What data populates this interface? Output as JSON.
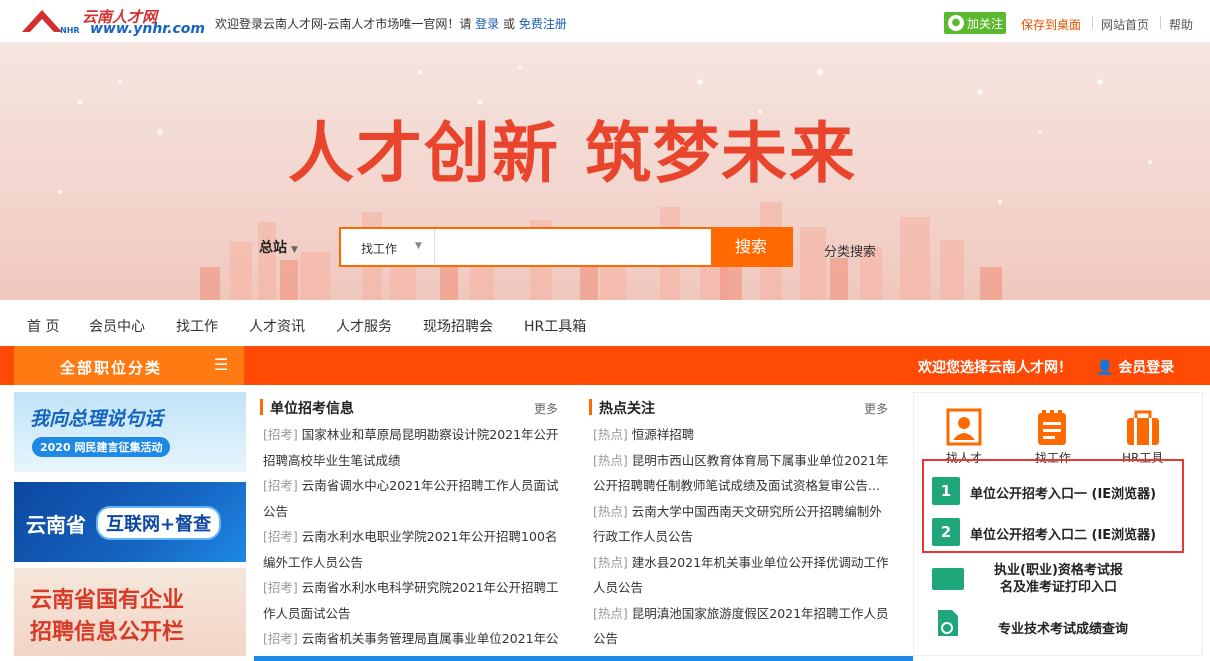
{
  "header": {
    "logo_cn": "云南人才网",
    "logo_en": "www.ynhr.com",
    "logo_mark": "NHR",
    "welcome_text": "欢迎登录云南人才网-云南人才市场唯一官网！请",
    "login_link": "登录",
    "or_text": "或",
    "register_link": "免费注册",
    "follow_label": "加关注",
    "save_desktop": "保存到桌面",
    "home_link": "网站首页",
    "help_link": "帮助"
  },
  "banner": {
    "slogan": "人才创新 筑梦未来",
    "site_select": "总站",
    "search_type": "找工作",
    "search_placeholder": "",
    "search_button": "搜索",
    "category_search": "分类搜索"
  },
  "nav": {
    "items": [
      "首 页",
      "会员中心",
      "找工作",
      "人才资讯",
      "人才服务",
      "现场招聘会",
      "HR工具箱"
    ]
  },
  "bar": {
    "all_categories": "全部职位分类",
    "welcome": "欢迎您选择云南人才网！",
    "member_login": "会员登录"
  },
  "ads": {
    "ad1_title": "我向总理说句话",
    "ad1_sub": "2020 网民建言征集活动",
    "ad2_left": "云南省",
    "ad2_right": "互联网+督查",
    "ad3_line1": "云南省国有企业",
    "ad3_line2": "招聘信息公开栏"
  },
  "recruit": {
    "title": "单位招考信息",
    "more": "更多",
    "lines": [
      {
        "tag": "[招考]",
        "text": " 国家林业和草原局昆明勘察设计院2021年公开"
      },
      {
        "tag": "",
        "text": "招聘高校毕业生笔试成绩"
      },
      {
        "tag": "[招考]",
        "text": " 云南省调水中心2021年公开招聘工作人员面试"
      },
      {
        "tag": "",
        "text": "公告"
      },
      {
        "tag": "[招考]",
        "text": " 云南水利水电职业学院2021年公开招聘100名"
      },
      {
        "tag": "",
        "text": "编外工作人员公告"
      },
      {
        "tag": "[招考]",
        "text": " 云南省水利水电科学研究院2021年公开招聘工"
      },
      {
        "tag": "",
        "text": "作人员面试公告"
      },
      {
        "tag": "[招考]",
        "text": " 云南省机关事务管理局直属事业单位2021年公"
      }
    ]
  },
  "hot": {
    "title": "热点关注",
    "more": "更多",
    "lines": [
      {
        "tag": "[热点]",
        "text": " 恒源祥招聘"
      },
      {
        "tag": "[热点]",
        "text": " 昆明市西山区教育体育局下属事业单位2021年"
      },
      {
        "tag": "",
        "text": "公开招聘聘任制教师笔试成绩及面试资格复审公告..."
      },
      {
        "tag": "[热点]",
        "text": " 云南大学中国西南天文研究所公开招聘编制外"
      },
      {
        "tag": "",
        "text": "行政工作人员公告"
      },
      {
        "tag": "[热点]",
        "text": " 建水县2021年机关事业单位公开择优调动工作"
      },
      {
        "tag": "",
        "text": "人员公告"
      },
      {
        "tag": "[热点]",
        "text": " 昆明滇池国家旅游度假区2021年招聘工作人员"
      },
      {
        "tag": "",
        "text": "公告"
      }
    ]
  },
  "tools": {
    "find_talent": "找人才",
    "find_job": "找工作",
    "hr_tools": "HR工具",
    "entry1_icon": "1",
    "entry1": "单位公开招考入口一 (IE浏览器)",
    "entry2_icon": "2",
    "entry2": "单位公开招考入口二 (IE浏览器)",
    "qualify_line1": "执业(职业)资格考试报",
    "qualify_line2": "名及准考证打印入口",
    "score_query": "专业技术考试成绩查询"
  }
}
